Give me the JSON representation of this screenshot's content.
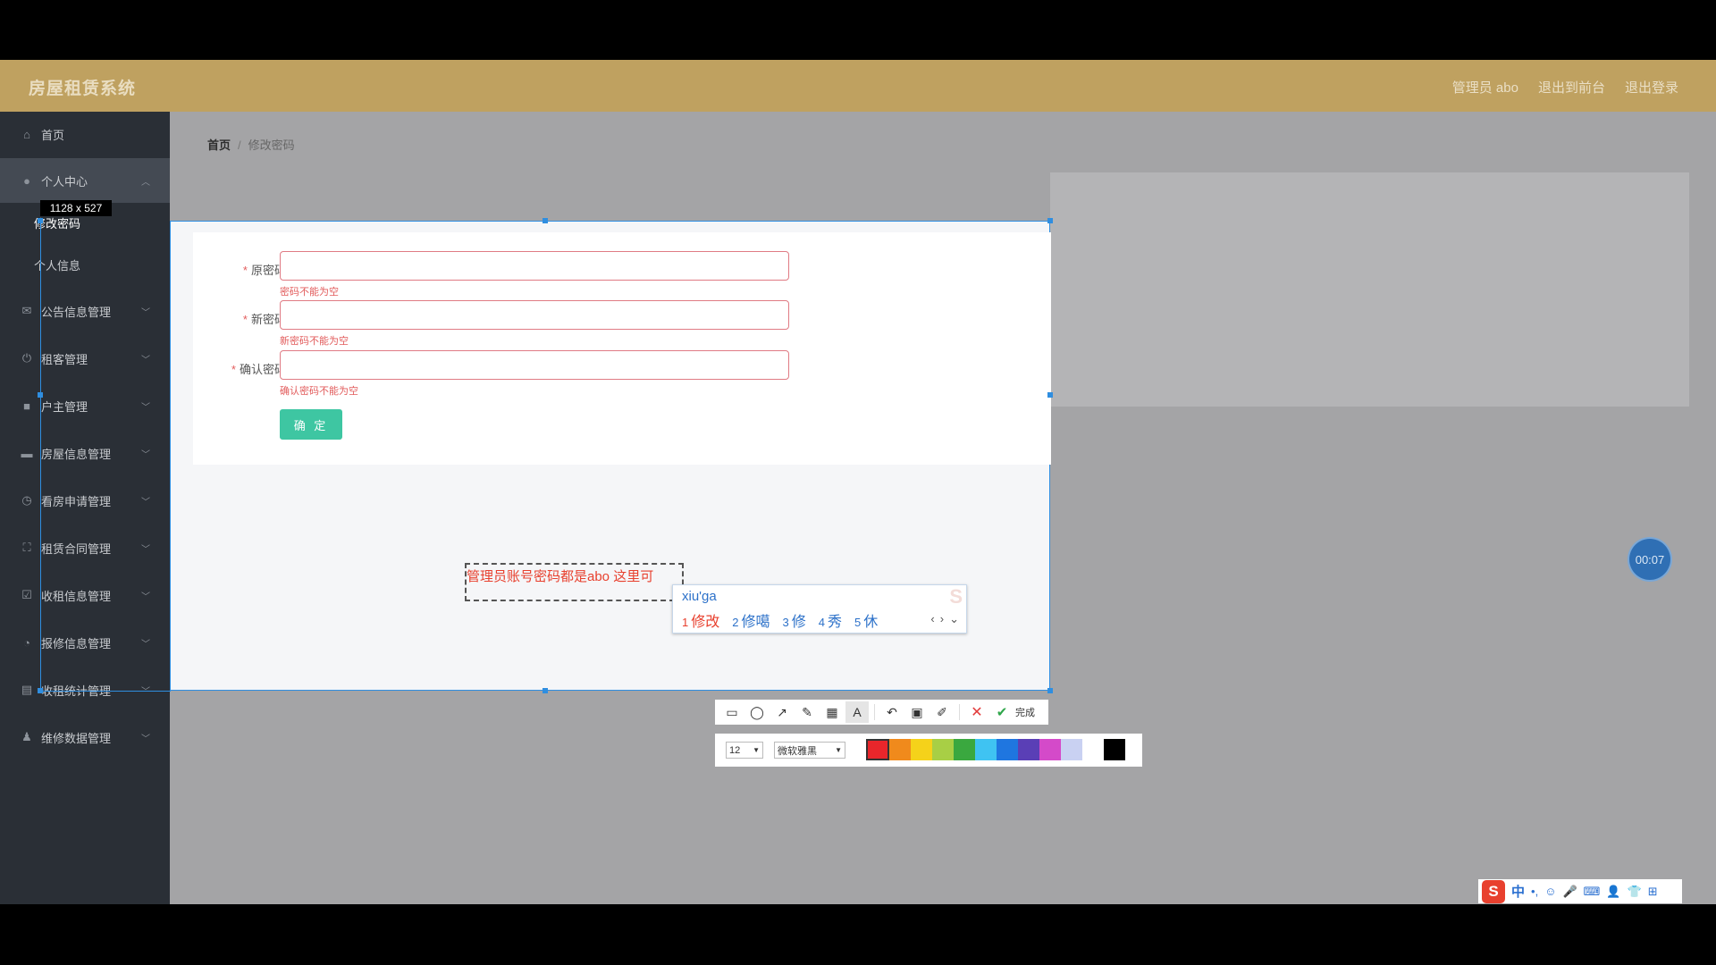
{
  "app": {
    "title": "房屋租赁系统",
    "header_links": [
      "管理员 abo",
      "退出到前台",
      "退出登录"
    ]
  },
  "sidebar": {
    "items": [
      {
        "label": "首页",
        "icon": "home-icon"
      },
      {
        "label": "个人中心",
        "icon": "user-icon",
        "expanded": true
      },
      {
        "label": "公告信息管理",
        "icon": "mail-icon"
      },
      {
        "label": "租客管理",
        "icon": "power-icon"
      },
      {
        "label": "户主管理",
        "icon": "briefcase-icon"
      },
      {
        "label": "房屋信息管理",
        "icon": "chat-icon"
      },
      {
        "label": "看房申请管理",
        "icon": "clock-icon"
      },
      {
        "label": "租赁合同管理",
        "icon": "expand-icon"
      },
      {
        "label": "收租信息管理",
        "icon": "checkbox-icon"
      },
      {
        "label": "报修信息管理",
        "icon": "compass-icon"
      },
      {
        "label": "收租统计管理",
        "icon": "trash-icon"
      },
      {
        "label": "维修数据管理",
        "icon": "person-icon"
      }
    ],
    "sub_items": [
      "修改密码",
      "个人信息"
    ]
  },
  "breadcrumb": {
    "home": "首页",
    "separator": "/",
    "current": "修改密码"
  },
  "form": {
    "fields": [
      {
        "label": "原密码",
        "required": "*",
        "value": "",
        "error": "密码不能为空"
      },
      {
        "label": "新密码",
        "required": "*",
        "value": "",
        "error": "新密码不能为空"
      },
      {
        "label": "确认密码",
        "required": "*",
        "value": "",
        "error": "确认密码不能为空"
      }
    ],
    "submit_label": "确 定"
  },
  "capture_tool": {
    "size_label": "1128 x 527",
    "annotation_text": "管理员账号密码都是abo 这里可",
    "toolbar_icons": [
      "rectangle-icon",
      "ellipse-icon",
      "arrow-icon",
      "pen-icon",
      "mosaic-icon",
      "text-icon",
      "undo-icon",
      "save-icon",
      "edit-icon",
      "cancel-icon",
      "confirm-icon"
    ],
    "done_label": "完成",
    "font_size": "12",
    "font_name": "微软雅黑",
    "colors": [
      "#e8262b",
      "#f08a1c",
      "#f5d21a",
      "#a8cf45",
      "#3aa83f",
      "#3fc3f2",
      "#1f76e0",
      "#5a3fb6",
      "#d44ac9",
      "#c9d1f2",
      "#ffffff",
      "#000000"
    ],
    "selected_color": "#e8262b"
  },
  "ime": {
    "pinyin": "xiu'ga",
    "candidates": [
      {
        "n": "1",
        "text": "修改"
      },
      {
        "n": "2",
        "text": "修噶"
      },
      {
        "n": "3",
        "text": "修"
      },
      {
        "n": "4",
        "text": "秀"
      },
      {
        "n": "5",
        "text": "休"
      }
    ],
    "status": [
      "S",
      "中",
      "•,",
      "☺",
      "🎤",
      "⌨",
      "👤",
      "👕",
      "⊞"
    ]
  },
  "timer": "00:07"
}
